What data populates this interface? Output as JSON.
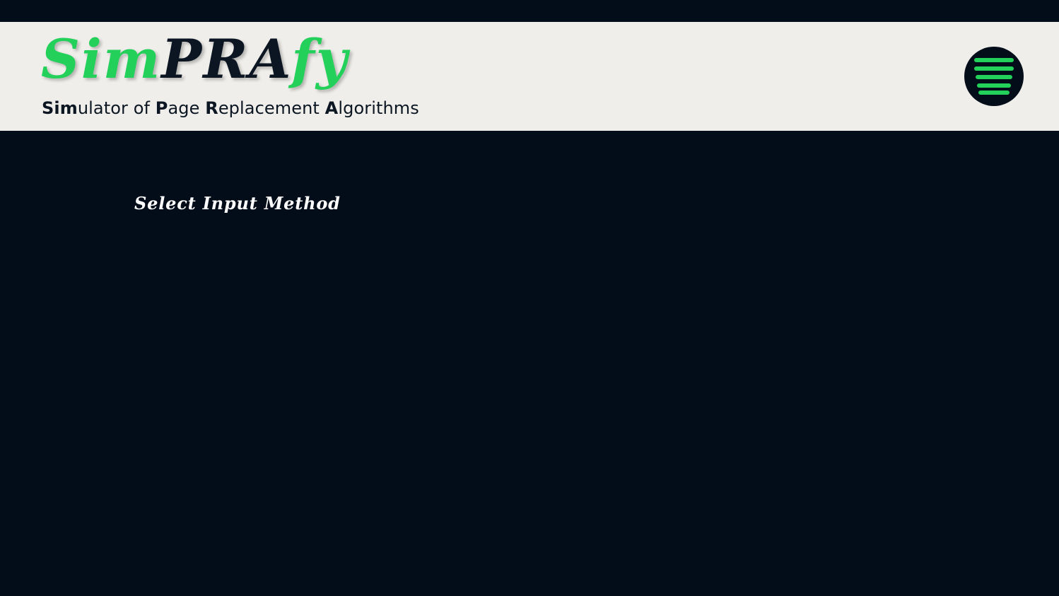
{
  "header": {
    "logo": {
      "part1": "Sim",
      "part2": "PRA",
      "part3": "fy"
    },
    "subtitle": {
      "s1_bold": "Sim",
      "s1_rest": "ulator of ",
      "s2_bold": "P",
      "s2_rest": "age ",
      "s3_bold": "R",
      "s3_rest": "eplacement ",
      "s4_bold": "A",
      "s4_rest": "lgorithms"
    },
    "menu_icon": "hamburger-menu-icon"
  },
  "main": {
    "section_title": "Select Input Method"
  },
  "colors": {
    "background": "#020d19",
    "header_background": "#f0eeea",
    "accent_green": "#22d05a",
    "dark_text": "#0b1622",
    "light_text": "#ffffff"
  }
}
